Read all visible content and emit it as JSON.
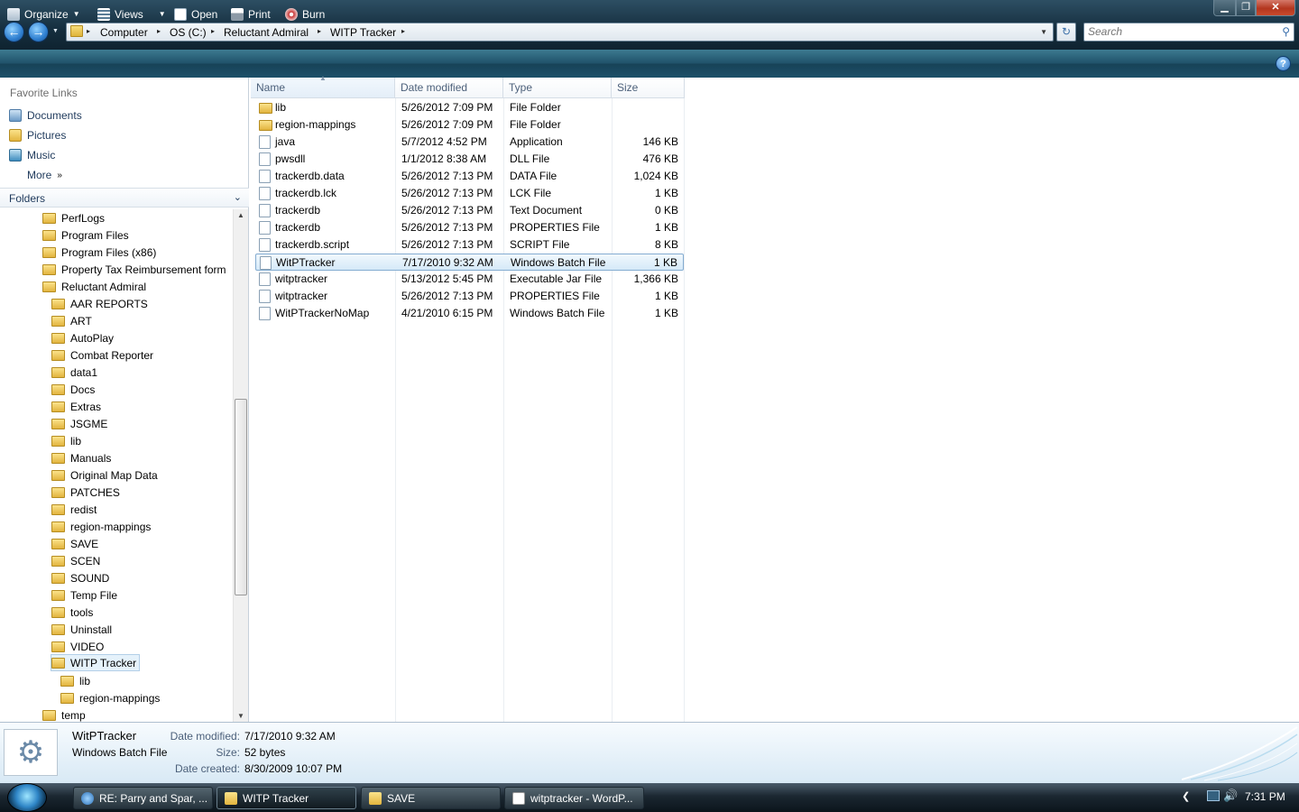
{
  "window": {
    "minimize_glyph": "▁",
    "maximize_glyph": "❐",
    "close_glyph": "✕"
  },
  "address": {
    "crumbs": [
      "Computer",
      "OS (C:)",
      "Reluctant Admiral",
      "WITP Tracker"
    ],
    "separator": "▸"
  },
  "search": {
    "placeholder": "Search"
  },
  "toolbar": {
    "organize": "Organize",
    "views": "Views",
    "open": "Open",
    "print": "Print",
    "burn": "Burn",
    "help": "?"
  },
  "nav": {
    "favorite_links_label": "Favorite Links",
    "favorites": [
      "Documents",
      "Pictures",
      "Music"
    ],
    "more": "More",
    "folders_label": "Folders"
  },
  "tree": [
    {
      "label": "PerfLogs",
      "depth": 0
    },
    {
      "label": "Program Files",
      "depth": 0
    },
    {
      "label": "Program Files (x86)",
      "depth": 0
    },
    {
      "label": "Property Tax Reimbursement form",
      "depth": 0
    },
    {
      "label": "Reluctant Admiral",
      "depth": 0
    },
    {
      "label": "AAR REPORTS",
      "depth": 1
    },
    {
      "label": "ART",
      "depth": 1
    },
    {
      "label": "AutoPlay",
      "depth": 1
    },
    {
      "label": "Combat Reporter",
      "depth": 1
    },
    {
      "label": "data1",
      "depth": 1
    },
    {
      "label": "Docs",
      "depth": 1
    },
    {
      "label": "Extras",
      "depth": 1
    },
    {
      "label": "JSGME",
      "depth": 1
    },
    {
      "label": "lib",
      "depth": 1
    },
    {
      "label": "Manuals",
      "depth": 1
    },
    {
      "label": "Original Map Data",
      "depth": 1
    },
    {
      "label": "PATCHES",
      "depth": 1
    },
    {
      "label": "redist",
      "depth": 1
    },
    {
      "label": "region-mappings",
      "depth": 1
    },
    {
      "label": "SAVE",
      "depth": 1
    },
    {
      "label": "SCEN",
      "depth": 1
    },
    {
      "label": "SOUND",
      "depth": 1
    },
    {
      "label": "Temp File",
      "depth": 1
    },
    {
      "label": "tools",
      "depth": 1
    },
    {
      "label": "Uninstall",
      "depth": 1
    },
    {
      "label": "VIDEO",
      "depth": 1
    },
    {
      "label": "WITP Tracker",
      "depth": 1,
      "selected": true
    },
    {
      "label": "lib",
      "depth": 2
    },
    {
      "label": "region-mappings",
      "depth": 2
    },
    {
      "label": "temp",
      "depth": 0
    }
  ],
  "columns": {
    "name": "Name",
    "date": "Date modified",
    "type": "Type",
    "size": "Size"
  },
  "files": [
    {
      "name": "lib",
      "date": "5/26/2012 7:09 PM",
      "type": "File Folder",
      "size": "",
      "kind": "folder"
    },
    {
      "name": "region-mappings",
      "date": "5/26/2012 7:09 PM",
      "type": "File Folder",
      "size": "",
      "kind": "folder"
    },
    {
      "name": "java",
      "date": "5/7/2012 4:52 PM",
      "type": "Application",
      "size": "146 KB",
      "kind": "file"
    },
    {
      "name": "pwsdll",
      "date": "1/1/2012 8:38 AM",
      "type": "DLL File",
      "size": "476 KB",
      "kind": "file"
    },
    {
      "name": "trackerdb.data",
      "date": "5/26/2012 7:13 PM",
      "type": "DATA File",
      "size": "1,024 KB",
      "kind": "file"
    },
    {
      "name": "trackerdb.lck",
      "date": "5/26/2012 7:13 PM",
      "type": "LCK File",
      "size": "1 KB",
      "kind": "file"
    },
    {
      "name": "trackerdb",
      "date": "5/26/2012 7:13 PM",
      "type": "Text Document",
      "size": "0 KB",
      "kind": "file"
    },
    {
      "name": "trackerdb",
      "date": "5/26/2012 7:13 PM",
      "type": "PROPERTIES File",
      "size": "1 KB",
      "kind": "file"
    },
    {
      "name": "trackerdb.script",
      "date": "5/26/2012 7:13 PM",
      "type": "SCRIPT File",
      "size": "8 KB",
      "kind": "file"
    },
    {
      "name": "WitPTracker",
      "date": "7/17/2010 9:32 AM",
      "type": "Windows Batch File",
      "size": "1 KB",
      "kind": "file",
      "selected": true
    },
    {
      "name": "witptracker",
      "date": "5/13/2012 5:45 PM",
      "type": "Executable Jar File",
      "size": "1,366 KB",
      "kind": "file"
    },
    {
      "name": "witptracker",
      "date": "5/26/2012 7:13 PM",
      "type": "PROPERTIES File",
      "size": "1 KB",
      "kind": "file"
    },
    {
      "name": "WitPTrackerNoMap",
      "date": "4/21/2010 6:15 PM",
      "type": "Windows Batch File",
      "size": "1 KB",
      "kind": "file"
    }
  ],
  "details": {
    "name": "WitPTracker",
    "type": "Windows Batch File",
    "date_modified_label": "Date modified:",
    "date_modified": "7/17/2010 9:32 AM",
    "size_label": "Size:",
    "size": "52 bytes",
    "date_created_label": "Date created:",
    "date_created": "8/30/2009 10:07 PM"
  },
  "taskbar": {
    "tasks": [
      "RE: Parry and Spar, ...",
      "WITP Tracker",
      "SAVE",
      "witptracker - WordP..."
    ],
    "clock": "7:31 PM"
  }
}
